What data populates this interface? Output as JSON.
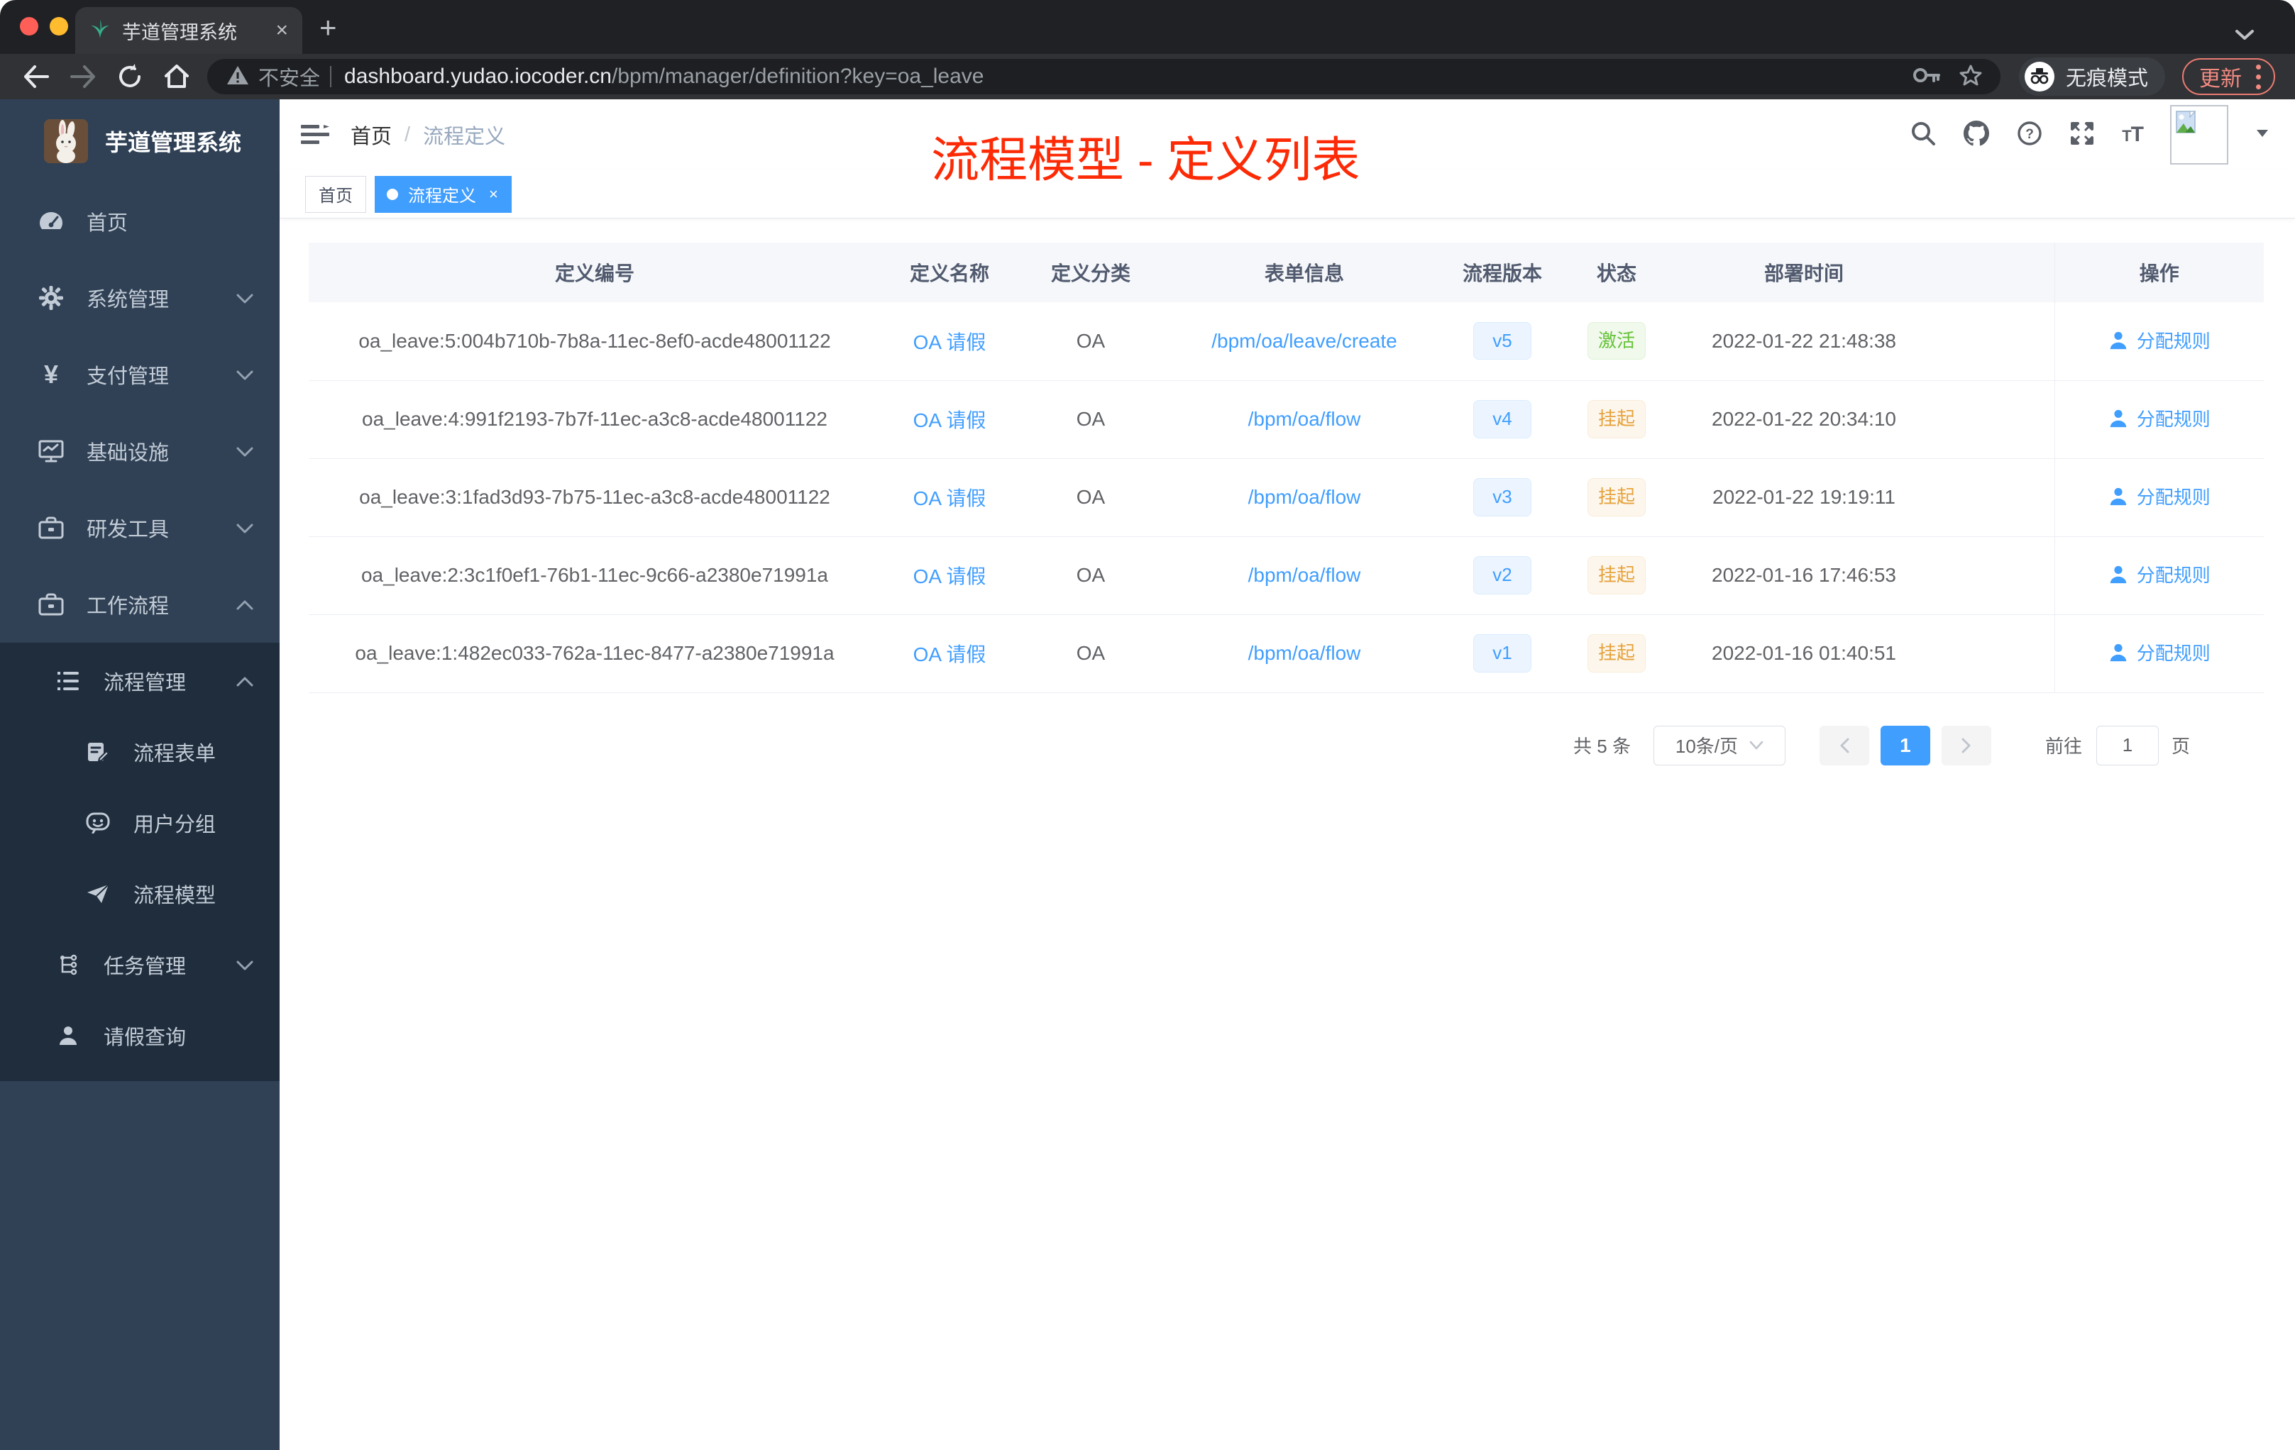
{
  "browser": {
    "tab_title": "芋道管理系统",
    "new_tab": "+",
    "close_tab": "×",
    "security_label": "不安全",
    "url_host": "dashboard.yudao.iocoder.cn",
    "url_path": "/bpm/manager/definition?key=oa_leave",
    "incognito_label": "无痕模式",
    "update_label": "更新"
  },
  "sidebar": {
    "logo_title": "芋道管理系统",
    "items": [
      {
        "label": "首页"
      },
      {
        "label": "系统管理"
      },
      {
        "label": "支付管理"
      },
      {
        "label": "基础设施"
      },
      {
        "label": "研发工具"
      },
      {
        "label": "工作流程"
      }
    ],
    "submenu": {
      "process_mgmt": "流程管理",
      "process_form": "流程表单",
      "user_group": "用户分组",
      "process_model": "流程模型",
      "task_mgmt": "任务管理",
      "leave_query": "请假查询"
    }
  },
  "header": {
    "breadcrumb": {
      "home": "首页",
      "current": "流程定义"
    },
    "annotation": "流程模型 - 定义列表"
  },
  "tags": {
    "home": "首页",
    "active": "流程定义",
    "close": "×"
  },
  "table": {
    "columns": [
      "定义编号",
      "定义名称",
      "定义分类",
      "表单信息",
      "流程版本",
      "状态",
      "部署时间",
      "操作"
    ],
    "action_label": "分配规则",
    "rows": [
      {
        "id": "oa_leave:5:004b710b-7b8a-11ec-8ef0-acde48001122",
        "name": "OA 请假",
        "category": "OA",
        "form": "/bpm/oa/leave/create",
        "version": "v5",
        "status": "激活",
        "deployed": "2022-01-22 21:48:38",
        "action": "分配规则"
      },
      {
        "id": "oa_leave:4:991f2193-7b7f-11ec-a3c8-acde48001122",
        "name": "OA 请假",
        "category": "OA",
        "form": "/bpm/oa/flow",
        "version": "v4",
        "status": "挂起",
        "deployed": "2022-01-22 20:34:10",
        "action": "分配规则"
      },
      {
        "id": "oa_leave:3:1fad3d93-7b75-11ec-a3c8-acde48001122",
        "name": "OA 请假",
        "category": "OA",
        "form": "/bpm/oa/flow",
        "version": "v3",
        "status": "挂起",
        "deployed": "2022-01-22 19:19:11",
        "action": "分配规则"
      },
      {
        "id": "oa_leave:2:3c1f0ef1-76b1-11ec-9c66-a2380e71991a",
        "name": "OA 请假",
        "category": "OA",
        "form": "/bpm/oa/flow",
        "version": "v2",
        "status": "挂起",
        "deployed": "2022-01-16 17:46:53",
        "action": "分配规则"
      },
      {
        "id": "oa_leave:1:482ec033-762a-11ec-8477-a2380e71991a",
        "name": "OA 请假",
        "category": "OA",
        "form": "/bpm/oa/flow",
        "version": "v1",
        "status": "挂起",
        "deployed": "2022-01-16 01:40:51",
        "action": "分配规则"
      }
    ]
  },
  "pagination": {
    "total": "共 5 条",
    "page_size": "10条/页",
    "current_page": "1",
    "goto_label": "前往",
    "goto_value": "1",
    "page_suffix": "页"
  },
  "colors": {
    "accent": "#409eff",
    "status_active": "#67c23a",
    "status_suspended": "#e6a23c",
    "annotation_red": "#fd2a06",
    "sidebar_bg": "#304156",
    "submenu_bg": "#1f2d3d"
  }
}
